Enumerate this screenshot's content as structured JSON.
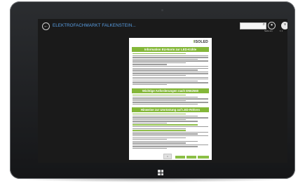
{
  "app": {
    "title": "ELEKTROFACHMARKT FALKENSTEIN..."
  },
  "toolbar": {
    "search_placeholder": "",
    "page_label": "Seite ein",
    "page_info": "1  1",
    "back_icon": "back-arrow-icon",
    "zoom_icon": "zoom-icon",
    "down_icon": "chevron-down-icon"
  },
  "document": {
    "logo_text": "ISOLED",
    "logo_sub": "",
    "band1": "Information EU-Norm zur LED-Kühle",
    "band2": "Wichtige Anforderungen nach EN62560",
    "band3": "Hinweise zur Umrüstung auf LED-Röhren",
    "page_number": "1"
  },
  "colors": {
    "accent_green": "#84b739",
    "title_blue": "#5aa0e6",
    "screen_bg": "#1a1a1a",
    "bezel": "#1f2023"
  }
}
